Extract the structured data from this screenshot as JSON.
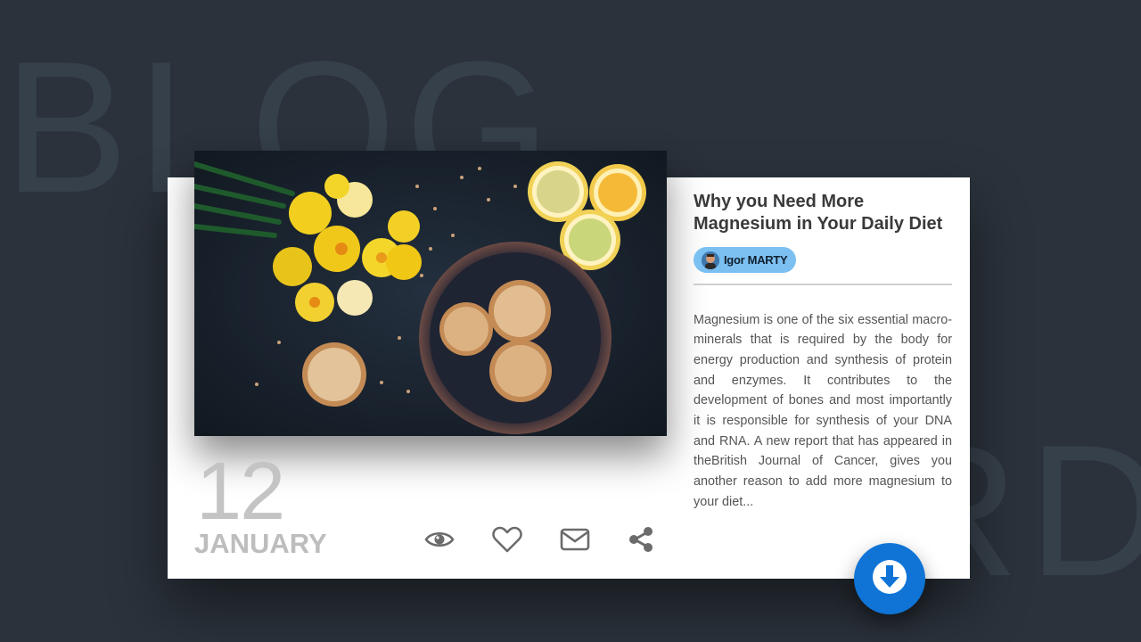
{
  "background": {
    "word_top": "BLOG",
    "word_bottom": "CARD"
  },
  "card": {
    "date": {
      "day": "12",
      "month": "JANUARY"
    },
    "actions": [
      {
        "icon": "eye-icon",
        "label": "view"
      },
      {
        "icon": "heart-icon",
        "label": "like"
      },
      {
        "icon": "mail-icon",
        "label": "mail"
      },
      {
        "icon": "share-icon",
        "label": "share"
      }
    ],
    "title": "Why you Need More Magnesium in Your Daily Diet",
    "author": {
      "name": "Igor MARTY"
    },
    "excerpt": "Magnesium is one of the six essential macro-minerals that is required by the body for energy production and synthesis of protein and enzymes. It contributes to the development of bones and most importantly it is responsible for synthesis of your DNA and RNA. A new report that has appeared in theBritish Journal of Cancer, gives you another reason to add more magnesium to your diet...",
    "fab_icon": "arrow-down-icon"
  },
  "colors": {
    "background": "#2b323b",
    "accent": "#0f74d6",
    "author_badge": "#7cc0f2"
  }
}
